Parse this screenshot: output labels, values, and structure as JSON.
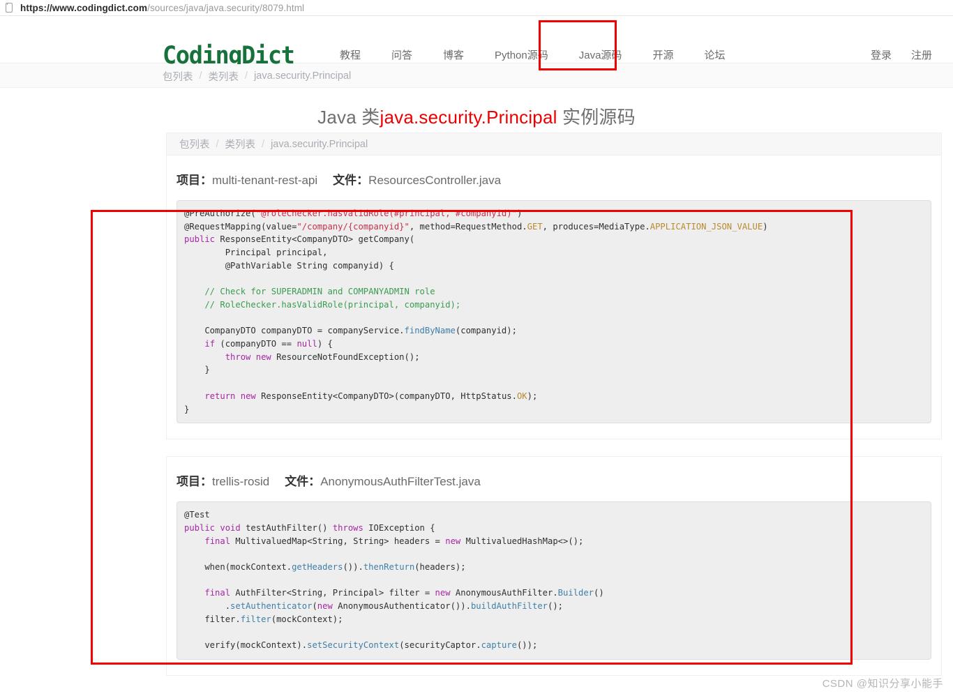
{
  "browser": {
    "url_scheme": "https://",
    "url_domain": "www.codingdict.com",
    "url_path": "/sources/java/java.security/8079.html",
    "lock_icon": "page-info-icon"
  },
  "header": {
    "logo_text": "CodingDict",
    "nav": [
      {
        "label": "教程"
      },
      {
        "label": "问答"
      },
      {
        "label": "博客"
      },
      {
        "label": "Python源码"
      },
      {
        "label": "Java源码",
        "highlighted": true
      },
      {
        "label": "开源"
      },
      {
        "label": "论坛"
      }
    ],
    "nav_right": [
      {
        "label": "登录"
      },
      {
        "label": "注册"
      }
    ]
  },
  "top_breadcrumb": {
    "items": [
      "包列表",
      "类列表",
      "java.security.Principal"
    ],
    "separator": "/"
  },
  "page_title": {
    "prefix": "Java 类",
    "highlight": "java.security.Principal",
    "suffix": " 实例源码"
  },
  "content_breadcrumb": {
    "items": [
      "包列表",
      "类列表",
      "java.security.Principal"
    ],
    "separator": "/"
  },
  "sections": [
    {
      "project_label": "项目：",
      "project_value": "multi-tenant-rest-api",
      "file_label": "文件：",
      "file_value": "ResourcesController.java",
      "code": "@PreAuthorize(\"@roleChecker.hasValidRole(#principal, #companyid)\")\n@RequestMapping(value=\"/company/{companyid}\", method=RequestMethod.GET, produces=MediaType.APPLICATION_JSON_VALUE)\npublic ResponseEntity<CompanyDTO> getCompany(\n        Principal principal,\n        @PathVariable String companyid) {\n\n    // Check for SUPERADMIN and COMPANYADMIN role\n    // RoleChecker.hasValidRole(principal, companyid);\n\n    CompanyDTO companyDTO = companyService.findByName(companyid);\n    if (companyDTO == null) {\n        throw new ResourceNotFoundException();\n    }\n\n    return new ResponseEntity<CompanyDTO>(companyDTO, HttpStatus.OK);\n}"
    },
    {
      "project_label": "项目：",
      "project_value": "trellis-rosid",
      "file_label": "文件：",
      "file_value": "AnonymousAuthFilterTest.java",
      "code": "@Test\npublic void testAuthFilter() throws IOException {\n    final MultivaluedMap<String, String> headers = new MultivaluedHashMap<>();\n\n    when(mockContext.getHeaders()).thenReturn(headers);\n\n    final AuthFilter<String, Principal> filter = new AnonymousAuthFilter.Builder()\n        .setAuthenticator(new AnonymousAuthenticator()).buildAuthFilter();\n    filter.filter(mockContext);\n\n    verify(mockContext).setSecurityContext(securityCaptor.capture());"
    }
  ],
  "annotations": [
    {
      "name": "nav-java-source-highlight",
      "color": "#f00000"
    },
    {
      "name": "code-region-highlight",
      "color": "#f00000"
    }
  ],
  "watermark": "CSDN @知识分享小能手"
}
